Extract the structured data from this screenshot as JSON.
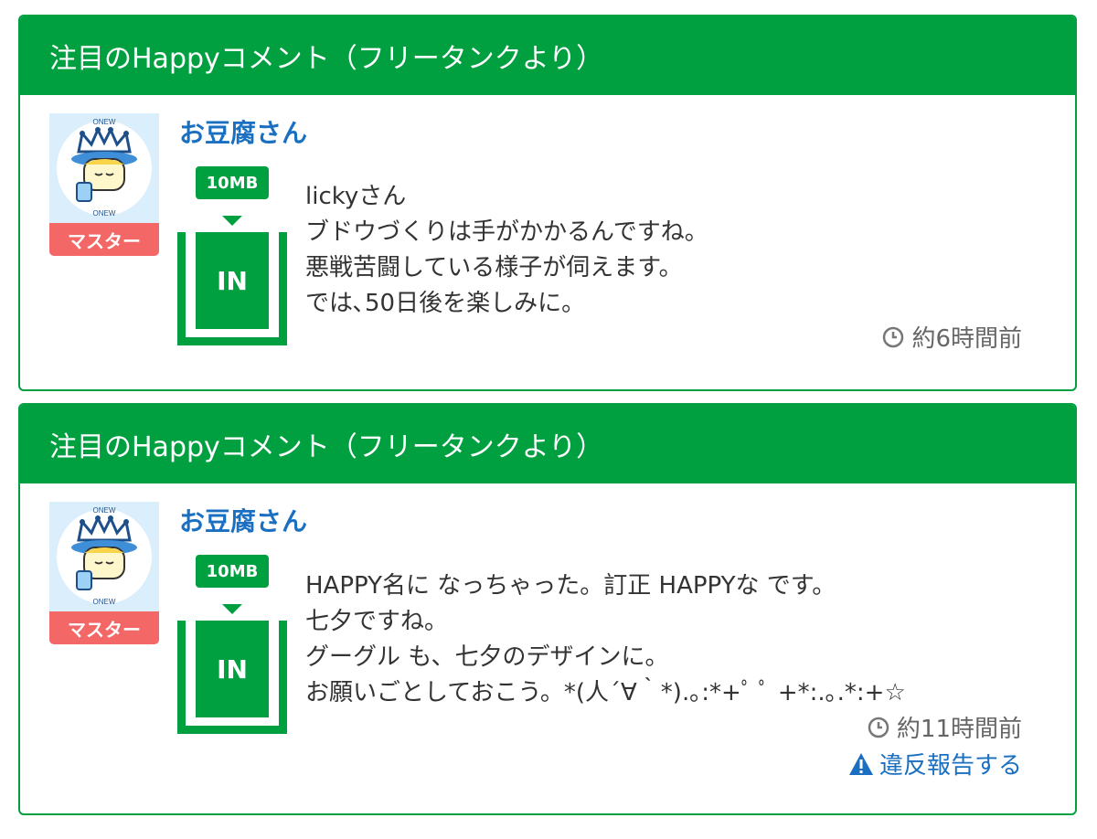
{
  "posts": [
    {
      "header": "注目のHappyコメント（フリータンクより）",
      "user_name": "お豆腐さん",
      "badge": "マスター",
      "avatar_icon": "crowned-character-avatar",
      "tank_size": "10MB",
      "tank_state": "IN",
      "comment_lines": [
        "lickyさん",
        "ブドウづくりは手がかかるんですね。",
        "悪戦苦闘している様子が伺えます。",
        "では､50日後を楽しみに。"
      ],
      "time": "約6時間前"
    },
    {
      "header": "注目のHappyコメント（フリータンクより）",
      "user_name": "お豆腐さん",
      "badge": "マスター",
      "avatar_icon": "crowned-character-avatar",
      "tank_size": "10MB",
      "tank_state": "IN",
      "comment_lines": [
        "HAPPY名に なっちゃった。訂正 HAPPYな です。",
        "七夕ですね。",
        "グーグル も、七夕のデザインに。",
        "お願いごとしておこう。*(人´∀｀*).｡:*+ﾟ ﾟ +*:.｡.*:+☆"
      ],
      "time": "約11時間前",
      "report_label": "違反報告する"
    }
  ],
  "colors": {
    "header_green": "#00a040",
    "name_blue": "#1a6fc0",
    "badge_red": "#f46767"
  }
}
